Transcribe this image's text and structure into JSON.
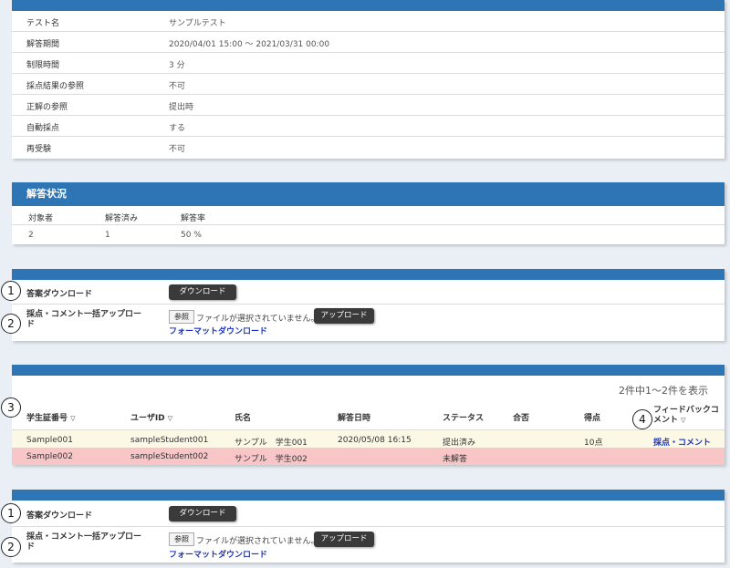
{
  "settings": {
    "rows": [
      {
        "label": "テスト名",
        "value": "サンプルテスト"
      },
      {
        "label": "解答期間",
        "value": "2020/04/01 15:00 ～ 2021/03/31 00:00"
      },
      {
        "label": "制限時間",
        "value": "3 分"
      },
      {
        "label": "採点結果の参照",
        "value": "不可"
      },
      {
        "label": "正解の参照",
        "value": "提出時"
      },
      {
        "label": "自動採点",
        "value": "する"
      },
      {
        "label": "再受験",
        "value": "不可"
      }
    ]
  },
  "status": {
    "title": "解答状況",
    "headers": [
      "対象者",
      "解答済み",
      "解答率"
    ],
    "values": [
      "2",
      "1",
      "50 %"
    ]
  },
  "actions": {
    "download_label": "答案ダウンロード",
    "download_button": "ダウンロード",
    "upload_label": "採点・コメント一括アップロー\nド",
    "browse_button": "参照",
    "no_file_text": "ファイルが選択されていません。",
    "upload_button": "アップロード",
    "format_link": "フォーマットダウンロード"
  },
  "results": {
    "count_text": "2件中1～2件を表示",
    "columns": {
      "student_id": "学生証番号",
      "user_id": "ユーザID",
      "name": "氏名",
      "answered_at": "解答日時",
      "status": "ステータス",
      "pass_fail": "合否",
      "score": "得点",
      "feedback": "フィードバックコメント"
    },
    "sort_mark": "▽",
    "rows": [
      {
        "student_id": "Sample001",
        "user_id": "sampleStudent001",
        "name": "サンプル　学生001",
        "answered_at": "2020/05/08 16:15",
        "status": "提出済み",
        "pass_fail": "",
        "score": "10点",
        "feedback": "採点・コメント"
      },
      {
        "student_id": "Sample002",
        "user_id": "sampleStudent002",
        "name": "サンプル　学生002",
        "answered_at": "",
        "status": "未解答",
        "pass_fail": "",
        "score": "",
        "feedback": ""
      }
    ]
  },
  "markers": [
    "1",
    "2",
    "3",
    "4"
  ],
  "colors": {
    "header_bar": "#2e75b6",
    "row_answered": "#fcf8e6",
    "row_unanswered": "#f8c6c6",
    "link": "#1a35c5"
  }
}
